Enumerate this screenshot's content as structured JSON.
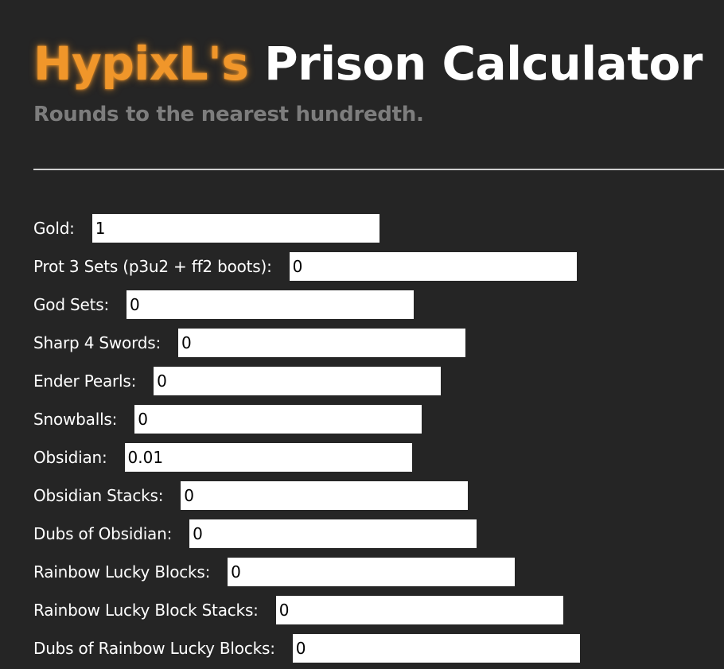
{
  "header": {
    "title_brand": "HypixL's",
    "title_rest": "Prison Calculator",
    "subtitle": "Rounds to the nearest hundredth."
  },
  "colors": {
    "background": "#252525",
    "brand_accent": "#f0962a",
    "subtitle": "#7d7d7d",
    "text": "#ffffff",
    "input_bg": "#ffffff"
  },
  "fields": [
    {
      "label": "Gold:",
      "value": "1"
    },
    {
      "label": "Prot 3 Sets (p3u2 + ff2 boots):",
      "value": "0"
    },
    {
      "label": "God Sets:",
      "value": "0"
    },
    {
      "label": "Sharp 4 Swords:",
      "value": "0"
    },
    {
      "label": "Ender Pearls:",
      "value": "0"
    },
    {
      "label": "Snowballs:",
      "value": "0"
    },
    {
      "label": "Obsidian:",
      "value": "0.01"
    },
    {
      "label": "Obsidian Stacks:",
      "value": "0"
    },
    {
      "label": "Dubs of Obsidian:",
      "value": "0"
    },
    {
      "label": "Rainbow Lucky Blocks:",
      "value": "0"
    },
    {
      "label": "Rainbow Lucky Block Stacks:",
      "value": "0"
    },
    {
      "label": "Dubs of Rainbow Lucky Blocks:",
      "value": "0"
    }
  ]
}
